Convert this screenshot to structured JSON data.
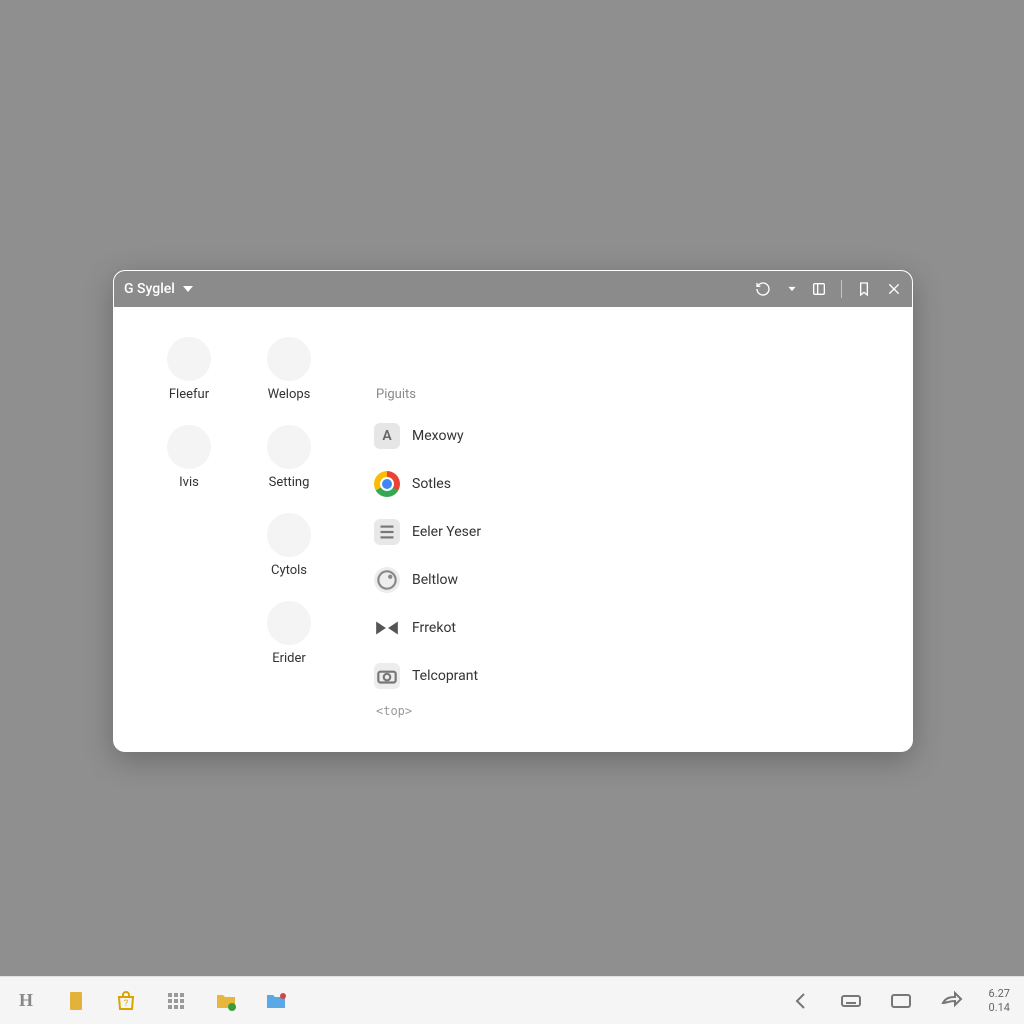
{
  "window": {
    "title": "G Syglel"
  },
  "categories": [
    {
      "label": "Fleefur"
    },
    {
      "label": "Welops"
    },
    {
      "label": "Ivis"
    },
    {
      "label": "Setting"
    },
    {
      "label": ""
    },
    {
      "label": "Cytols"
    },
    {
      "label": ""
    },
    {
      "label": "Erider"
    }
  ],
  "detail": {
    "section_title": "Piguits",
    "items": [
      {
        "label": "Mexowy",
        "icon": "letter-a"
      },
      {
        "label": "Sotles",
        "icon": "chrome"
      },
      {
        "label": "Eeler Yeser",
        "icon": "document"
      },
      {
        "label": "Beltlow",
        "icon": "generic"
      },
      {
        "label": "Frrekot",
        "icon": "bowtie"
      },
      {
        "label": "Telcoprant",
        "icon": "camera"
      }
    ],
    "tag_hint": "<top>"
  },
  "taskbar": {
    "clock_line1": "6.27",
    "clock_line2": "0.14"
  }
}
